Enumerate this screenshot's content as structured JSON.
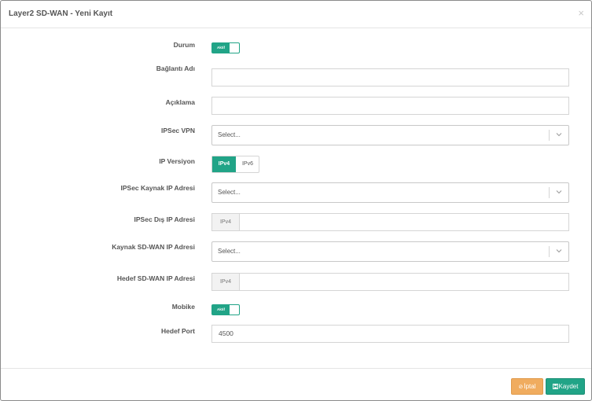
{
  "modal": {
    "title": "Layer2 SD-WAN - Yeni Kayıt",
    "close_glyph": "×"
  },
  "form": {
    "durum": {
      "label": "Durum",
      "toggle_label": "Aktif",
      "on": true
    },
    "baglanti_adi": {
      "label": "Bağlantı Adı",
      "value": ""
    },
    "aciklama": {
      "label": "Açıklama",
      "value": ""
    },
    "ipsec_vpn": {
      "label": "IPSec VPN",
      "placeholder": "Select..."
    },
    "ip_versiyon": {
      "label": "IP Versiyon",
      "options": [
        "IPv4",
        "IPv6"
      ],
      "selected": "IPv4"
    },
    "ipsec_kaynak_ip": {
      "label": "IPSec Kaynak IP Adresi",
      "placeholder": "Select..."
    },
    "ipsec_dis_ip": {
      "label": "IPSec Dış IP Adresi",
      "addon": "IPv4",
      "value": ""
    },
    "kaynak_sdwan_ip": {
      "label": "Kaynak SD-WAN IP Adresi",
      "placeholder": "Select..."
    },
    "hedef_sdwan_ip": {
      "label": "Hedef SD-WAN IP Adresi",
      "addon": "IPv4",
      "value": ""
    },
    "mobike": {
      "label": "Mobike",
      "toggle_label": "Aktif",
      "on": true
    },
    "hedef_port": {
      "label": "Hedef Port",
      "value": "4500"
    }
  },
  "footer": {
    "cancel_label": "İptal",
    "cancel_icon": "ban-icon",
    "save_label": "Kaydet",
    "save_icon": "floppy-icon"
  },
  "colors": {
    "accent": "#21a487",
    "cancel": "#f0ac5f"
  }
}
